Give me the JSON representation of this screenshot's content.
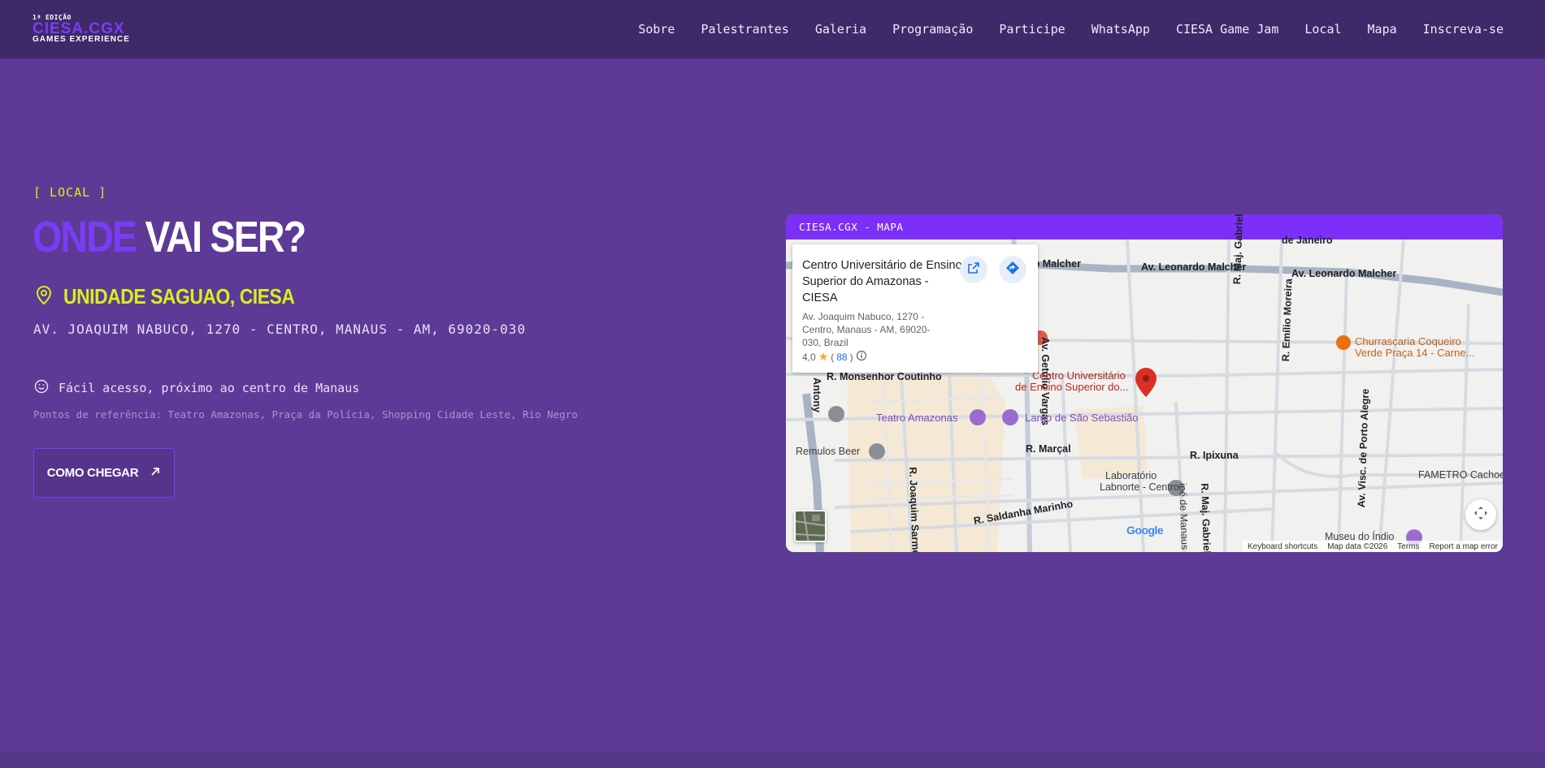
{
  "brand": {
    "edition": "1ª EDIÇÃO",
    "name": "CIESA.CGX",
    "tagline": "GAMES EXPERIENCE"
  },
  "nav": [
    {
      "label": "Sobre"
    },
    {
      "label": "Palestrantes"
    },
    {
      "label": "Galeria"
    },
    {
      "label": "Programação"
    },
    {
      "label": "Participe"
    },
    {
      "label": "WhatsApp"
    },
    {
      "label": "CIESA Game Jam"
    },
    {
      "label": "Local"
    },
    {
      "label": "Mapa"
    },
    {
      "label": "Inscreva-se"
    }
  ],
  "section": {
    "eyebrow": "[ LOCAL ]",
    "headline_accent": "ONDE",
    "headline_rest": "VAI SER?",
    "venue_name": "UNIDADE SAGUAO, CIESA",
    "address": "AV. JOAQUIM NABUCO, 1270 - CENTRO, MANAUS - AM, 69020-030",
    "access_note": "Fácil acesso, próximo ao centro de Manaus",
    "references": "Pontos de referência: Teatro Amazonas, Praça da Polícia, Shopping Cidade Leste, Rio Negro",
    "cta_label": "COMO CHEGAR"
  },
  "map": {
    "bar_title": "CIESA.CGX - MAPA",
    "place_title": "Centro Universitário de Ensino Superior do Amazonas - CIESA",
    "place_address": "Av. Joaquim Nabuco, 1270 - Centro, Manaus - AM, 69020-030, Brazil",
    "rating": "4,0",
    "review_count": "88",
    "labels": {
      "de_janeiro": "de Janeiro",
      "malcher_1": "do Malcher",
      "malcher_2": "Av. Leonardo Malcher",
      "malcher_3": "Av. Leonardo Malcher",
      "getulio": "Av. Getúlio Vargas",
      "maj_gabriel": "R. Maj. Gabriel",
      "emilio": "R. Emílio Moreira",
      "churrascaria_1": "Churrascaria Coqueiro",
      "churrascaria_2": "Verde Praça 14 - Carne...",
      "monsenhor": "R. Monsenhor Coutinho",
      "ciesa_pin_1": "Centro Universitário",
      "ciesa_pin_2": "de Ensino Superior do...",
      "antony": "Antony",
      "teatro": "Teatro Amazonas",
      "largo": "Largo de São Sebastião",
      "remulos": "Remulos Beer",
      "marcal": "R. Marçal",
      "ipixuna": "R. Ipixuna",
      "visc": "Av. Visc. de Porto Alegre",
      "fametro": "FAMETRO Cachoeir",
      "laboratorio_1": "Laboratório",
      "laboratorio_2": "Labnorte - Centro",
      "joaquim_sarmento": "R. Joaquim Sarme",
      "saldanha": "R. Saldanha Marinho",
      "maj_gabriel_2": "R. Maj. Gabriel",
      "museu": "Museu do Índio",
      "manaus_st": "ipé de Manaus"
    },
    "google": "Google",
    "footer": {
      "shortcuts": "Keyboard shortcuts",
      "data": "Map data ©2026",
      "terms": "Terms",
      "report": "Report a map error"
    }
  }
}
